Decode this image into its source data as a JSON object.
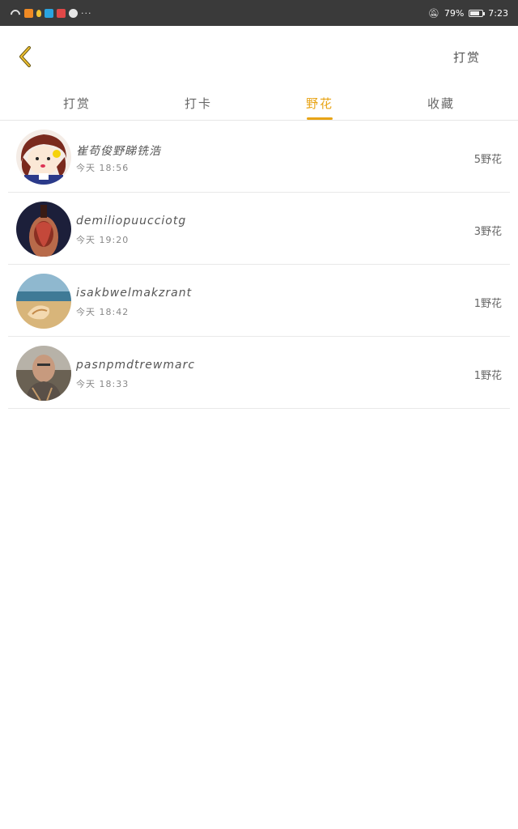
{
  "status_bar": {
    "battery": "79%",
    "time": "7:23",
    "more": "···",
    "battery_level": 0.79
  },
  "header": {
    "back_icon": "chevron-left-icon",
    "action_label": "打赏"
  },
  "tabs": [
    {
      "label": "打赏",
      "active": false
    },
    {
      "label": "打卡",
      "active": false
    },
    {
      "label": "野花",
      "active": true
    },
    {
      "label": "收藏",
      "active": false
    }
  ],
  "list": [
    {
      "name": "崔苟俊野睇铣浩",
      "time": "今天 18:56",
      "amount": "5野花"
    },
    {
      "name": "demiliopuucciotg",
      "time": "今天 19:20",
      "amount": "3野花"
    },
    {
      "name": "isakbwelmakzrant",
      "time": "今天 18:42",
      "amount": "1野花"
    },
    {
      "name": "pasnpmdtrewmarc",
      "time": "今天 18:33",
      "amount": "1野花"
    }
  ],
  "colors": {
    "accent": "#e8a416",
    "status_bar": "#3a3a3a",
    "divider": "#e9e9e9"
  }
}
